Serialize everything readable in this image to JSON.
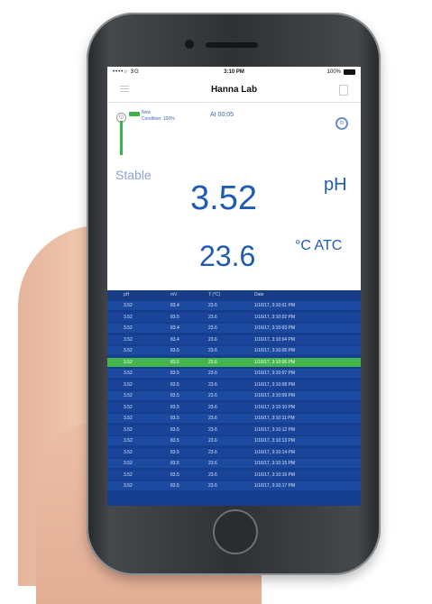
{
  "status_bar": {
    "signal": "••••○ 3G",
    "time": "3:10 PM",
    "battery": "100%"
  },
  "nav": {
    "title": "Hanna Lab",
    "menu_icon": "hamburger-menu-icon",
    "share_icon": "share-icon"
  },
  "probe": {
    "line1": "New",
    "line2": "Condition: 100%",
    "timer": "AI 00:05",
    "settings_icon": "gear-icon"
  },
  "reading": {
    "status": "Stable",
    "ph_value": "3.52",
    "ph_unit": "pH",
    "temp_value": "23.6",
    "temp_unit": "°C ATC"
  },
  "log": {
    "headers": [
      "pH",
      "mV",
      "T (°C)",
      "Date"
    ],
    "rows": [
      {
        "ph": "3.52",
        "mv": "83.4",
        "t": "23.6",
        "date": "1/16/17, 3:10:01 PM"
      },
      {
        "ph": "3.52",
        "mv": "83.5",
        "t": "23.6",
        "date": "1/16/17, 3:10:02 PM"
      },
      {
        "ph": "3.52",
        "mv": "83.4",
        "t": "23.6",
        "date": "1/16/17, 3:10:03 PM"
      },
      {
        "ph": "3.52",
        "mv": "83.4",
        "t": "23.6",
        "date": "1/16/17, 3:10:04 PM"
      },
      {
        "ph": "3.52",
        "mv": "83.5",
        "t": "23.6",
        "date": "1/16/17, 3:10:05 PM"
      },
      {
        "ph": "3.52",
        "mv": "83.5",
        "t": "23.6",
        "date": "1/16/17, 3:10:06 PM"
      },
      {
        "ph": "3.52",
        "mv": "83.5",
        "t": "23.6",
        "date": "1/16/17, 3:10:07 PM"
      },
      {
        "ph": "3.52",
        "mv": "83.5",
        "t": "23.6",
        "date": "1/16/17, 3:10:08 PM"
      },
      {
        "ph": "3.52",
        "mv": "83.5",
        "t": "23.6",
        "date": "1/16/17, 3:10:09 PM"
      },
      {
        "ph": "3.52",
        "mv": "83.5",
        "t": "23.6",
        "date": "1/16/17, 3:10:10 PM"
      },
      {
        "ph": "3.52",
        "mv": "83.5",
        "t": "23.6",
        "date": "1/16/17, 3:10:11 PM"
      },
      {
        "ph": "3.52",
        "mv": "83.5",
        "t": "23.6",
        "date": "1/16/17, 3:10:12 PM"
      },
      {
        "ph": "3.52",
        "mv": "83.5",
        "t": "23.6",
        "date": "1/16/17, 3:10:13 PM"
      },
      {
        "ph": "3.52",
        "mv": "83.5",
        "t": "23.6",
        "date": "1/16/17, 3:10:14 PM"
      },
      {
        "ph": "3.52",
        "mv": "83.5",
        "t": "23.6",
        "date": "1/16/17, 3:10:15 PM"
      },
      {
        "ph": "3.52",
        "mv": "83.5",
        "t": "23.6",
        "date": "1/16/17, 3:10:16 PM"
      },
      {
        "ph": "3.52",
        "mv": "83.5",
        "t": "23.6",
        "date": "1/16/17, 3:10:17 PM"
      }
    ],
    "selected_row": 5
  },
  "colors": {
    "accent_blue": "#1f5bb0",
    "table_bg": "#1c4aa1",
    "selected_green": "#43b54c"
  }
}
